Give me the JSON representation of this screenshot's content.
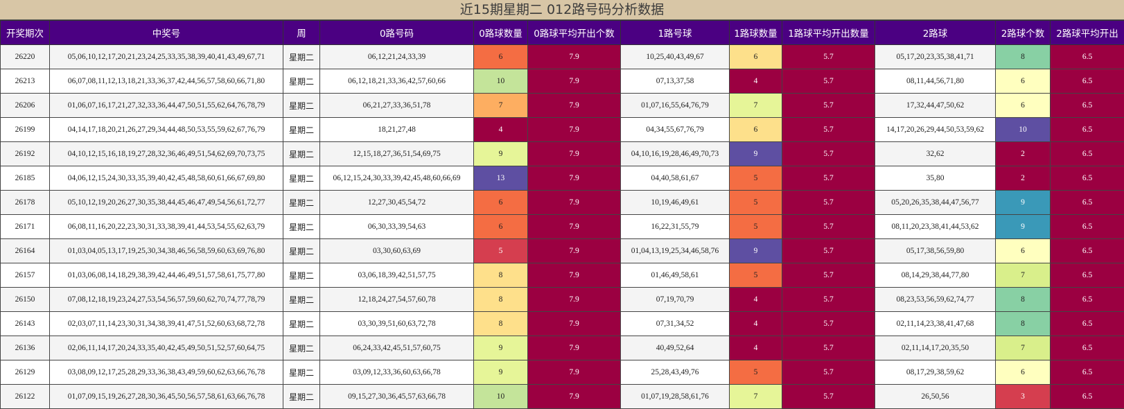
{
  "title": "近15期星期二 012路号码分析数据",
  "headers": [
    "开奖期次",
    "中奖号",
    "周",
    "0路号码",
    "0路球数量",
    "0路球平均开出个数",
    "1路号球",
    "1路球数量",
    "1路球平均开出数量",
    "2路球",
    "2路球个数",
    "2路球平均开出"
  ],
  "rows": [
    {
      "issue": "26220",
      "numbers": "05,06,10,12,17,20,21,23,24,25,33,35,38,39,40,41,43,49,67,71",
      "week": "星期二",
      "r0": "06,12,21,24,33,39",
      "c0": "6",
      "a0": "7.9",
      "r1": "10,25,40,43,49,67",
      "c1": "6",
      "a1": "5.7",
      "r2": "05,17,20,23,35,38,41,71",
      "c2": "8",
      "a2": "6.5"
    },
    {
      "issue": "26213",
      "numbers": "06,07,08,11,12,13,18,21,33,36,37,42,44,56,57,58,60,66,71,80",
      "week": "星期二",
      "r0": "06,12,18,21,33,36,42,57,60,66",
      "c0": "10",
      "a0": "7.9",
      "r1": "07,13,37,58",
      "c1": "4",
      "a1": "5.7",
      "r2": "08,11,44,56,71,80",
      "c2": "6",
      "a2": "6.5"
    },
    {
      "issue": "26206",
      "numbers": "01,06,07,16,17,21,27,32,33,36,44,47,50,51,55,62,64,76,78,79",
      "week": "星期二",
      "r0": "06,21,27,33,36,51,78",
      "c0": "7",
      "a0": "7.9",
      "r1": "01,07,16,55,64,76,79",
      "c1": "7",
      "a1": "5.7",
      "r2": "17,32,44,47,50,62",
      "c2": "6",
      "a2": "6.5"
    },
    {
      "issue": "26199",
      "numbers": "04,14,17,18,20,21,26,27,29,34,44,48,50,53,55,59,62,67,76,79",
      "week": "星期二",
      "r0": "18,21,27,48",
      "c0": "4",
      "a0": "7.9",
      "r1": "04,34,55,67,76,79",
      "c1": "6",
      "a1": "5.7",
      "r2": "14,17,20,26,29,44,50,53,59,62",
      "c2": "10",
      "a2": "6.5"
    },
    {
      "issue": "26192",
      "numbers": "04,10,12,15,16,18,19,27,28,32,36,46,49,51,54,62,69,70,73,75",
      "week": "星期二",
      "r0": "12,15,18,27,36,51,54,69,75",
      "c0": "9",
      "a0": "7.9",
      "r1": "04,10,16,19,28,46,49,70,73",
      "c1": "9",
      "a1": "5.7",
      "r2": "32,62",
      "c2": "2",
      "a2": "6.5"
    },
    {
      "issue": "26185",
      "numbers": "04,06,12,15,24,30,33,35,39,40,42,45,48,58,60,61,66,67,69,80",
      "week": "星期二",
      "r0": "06,12,15,24,30,33,39,42,45,48,60,66,69",
      "c0": "13",
      "a0": "7.9",
      "r1": "04,40,58,61,67",
      "c1": "5",
      "a1": "5.7",
      "r2": "35,80",
      "c2": "2",
      "a2": "6.5"
    },
    {
      "issue": "26178",
      "numbers": "05,10,12,19,20,26,27,30,35,38,44,45,46,47,49,54,56,61,72,77",
      "week": "星期二",
      "r0": "12,27,30,45,54,72",
      "c0": "6",
      "a0": "7.9",
      "r1": "10,19,46,49,61",
      "c1": "5",
      "a1": "5.7",
      "r2": "05,20,26,35,38,44,47,56,77",
      "c2": "9",
      "a2": "6.5"
    },
    {
      "issue": "26171",
      "numbers": "06,08,11,16,20,22,23,30,31,33,38,39,41,44,53,54,55,62,63,79",
      "week": "星期二",
      "r0": "06,30,33,39,54,63",
      "c0": "6",
      "a0": "7.9",
      "r1": "16,22,31,55,79",
      "c1": "5",
      "a1": "5.7",
      "r2": "08,11,20,23,38,41,44,53,62",
      "c2": "9",
      "a2": "6.5"
    },
    {
      "issue": "26164",
      "numbers": "01,03,04,05,13,17,19,25,30,34,38,46,56,58,59,60,63,69,76,80",
      "week": "星期二",
      "r0": "03,30,60,63,69",
      "c0": "5",
      "a0": "7.9",
      "r1": "01,04,13,19,25,34,46,58,76",
      "c1": "9",
      "a1": "5.7",
      "r2": "05,17,38,56,59,80",
      "c2": "6",
      "a2": "6.5"
    },
    {
      "issue": "26157",
      "numbers": "01,03,06,08,14,18,29,38,39,42,44,46,49,51,57,58,61,75,77,80",
      "week": "星期二",
      "r0": "03,06,18,39,42,51,57,75",
      "c0": "8",
      "a0": "7.9",
      "r1": "01,46,49,58,61",
      "c1": "5",
      "a1": "5.7",
      "r2": "08,14,29,38,44,77,80",
      "c2": "7",
      "a2": "6.5"
    },
    {
      "issue": "26150",
      "numbers": "07,08,12,18,19,23,24,27,53,54,56,57,59,60,62,70,74,77,78,79",
      "week": "星期二",
      "r0": "12,18,24,27,54,57,60,78",
      "c0": "8",
      "a0": "7.9",
      "r1": "07,19,70,79",
      "c1": "4",
      "a1": "5.7",
      "r2": "08,23,53,56,59,62,74,77",
      "c2": "8",
      "a2": "6.5"
    },
    {
      "issue": "26143",
      "numbers": "02,03,07,11,14,23,30,31,34,38,39,41,47,51,52,60,63,68,72,78",
      "week": "星期二",
      "r0": "03,30,39,51,60,63,72,78",
      "c0": "8",
      "a0": "7.9",
      "r1": "07,31,34,52",
      "c1": "4",
      "a1": "5.7",
      "r2": "02,11,14,23,38,41,47,68",
      "c2": "8",
      "a2": "6.5"
    },
    {
      "issue": "26136",
      "numbers": "02,06,11,14,17,20,24,33,35,40,42,45,49,50,51,52,57,60,64,75",
      "week": "星期二",
      "r0": "06,24,33,42,45,51,57,60,75",
      "c0": "9",
      "a0": "7.9",
      "r1": "40,49,52,64",
      "c1": "4",
      "a1": "5.7",
      "r2": "02,11,14,17,20,35,50",
      "c2": "7",
      "a2": "6.5"
    },
    {
      "issue": "26129",
      "numbers": "03,08,09,12,17,25,28,29,33,36,38,43,49,59,60,62,63,66,76,78",
      "week": "星期二",
      "r0": "03,09,12,33,36,60,63,66,78",
      "c0": "9",
      "a0": "7.9",
      "r1": "25,28,43,49,76",
      "c1": "5",
      "a1": "5.7",
      "r2": "08,17,29,38,59,62",
      "c2": "6",
      "a2": "6.5"
    },
    {
      "issue": "26122",
      "numbers": "01,07,09,15,19,26,27,28,30,36,45,50,56,57,58,61,63,66,76,78",
      "week": "星期二",
      "r0": "09,15,27,30,36,45,57,63,66,78",
      "c0": "10",
      "a0": "7.9",
      "r1": "01,07,19,28,58,61,76",
      "c1": "7",
      "a1": "5.7",
      "r2": "26,50,56",
      "c2": "3",
      "a2": "6.5"
    }
  ],
  "count_colors": {
    "2": "#9b0041",
    "3": "#d53e4f",
    "4": "#9b0041",
    "5": "#f46d43",
    "6": "#fdae61",
    "7": "#e6f598",
    "8": "#fee08b",
    "9": "#5e4fa2",
    "10": "#3288bd",
    "13": "#5e4fa2"
  },
  "col_colors": {
    "c0": {
      "4": "#9b0041",
      "5": "#d53e4f",
      "6": "#f46d43",
      "7": "#fdae61",
      "8": "#fee08b",
      "9": "#e6f598",
      "10": "#c4e49a",
      "13": "#5e4fa2"
    },
    "c1": {
      "4": "#9b0041",
      "5": "#f46d43",
      "6": "#fde08b",
      "7": "#e6f598",
      "9": "#5e4fa2"
    },
    "c2": {
      "2": "#9b0041",
      "3": "#d53e4f",
      "6": "#ffffbf",
      "7": "#d9ef8b",
      "8": "#88d0a4",
      "9": "#3a99b8",
      "10": "#5e4fa2"
    }
  },
  "dark_text_colors": [
    "#9b0041",
    "#d53e4f",
    "#5e4fa2",
    "#3a99b8"
  ]
}
